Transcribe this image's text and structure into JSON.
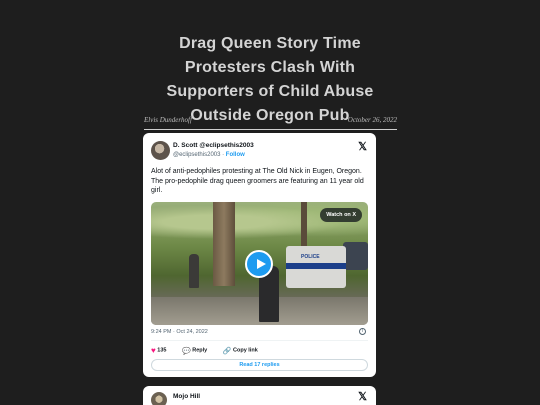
{
  "article": {
    "title": "Drag Queen Story Time Protesters Clash With Supporters of Child Abuse Outside Oregon Pub",
    "author": "Elvis Dunderhoff",
    "date": "October 26, 2022"
  },
  "tweet": {
    "display_name": "D. Scott @eclipsethis2003",
    "handle": "@eclipsethis2003",
    "separator": "·",
    "follow_label": "Follow",
    "text": "Alot of anti-pedophiles protesting at The Old Nick in Eugen, Oregon. The pro-pedophile drag queen groomers are featuring an 11 year old girl.",
    "media": {
      "watch_label": "Watch on X",
      "vehicle_text": "POLICE"
    },
    "timestamp": "9:24 PM · Oct 24, 2022",
    "likes": "135",
    "reply_label": "Reply",
    "copy_link_label": "Copy link",
    "read_replies_label": "Read 17 replies",
    "icons": {
      "verified": "verified-badge-icon",
      "platform": "x-logo-icon",
      "like": "heart-icon",
      "reply": "reply-icon",
      "link": "link-icon",
      "info": "info-icon",
      "play": "play-icon"
    }
  },
  "tweet2": {
    "display_name": "Mojo Hill"
  },
  "colors": {
    "page_background": "#1e1e1e",
    "accent": "#1d9bf0",
    "like": "#f91880"
  }
}
